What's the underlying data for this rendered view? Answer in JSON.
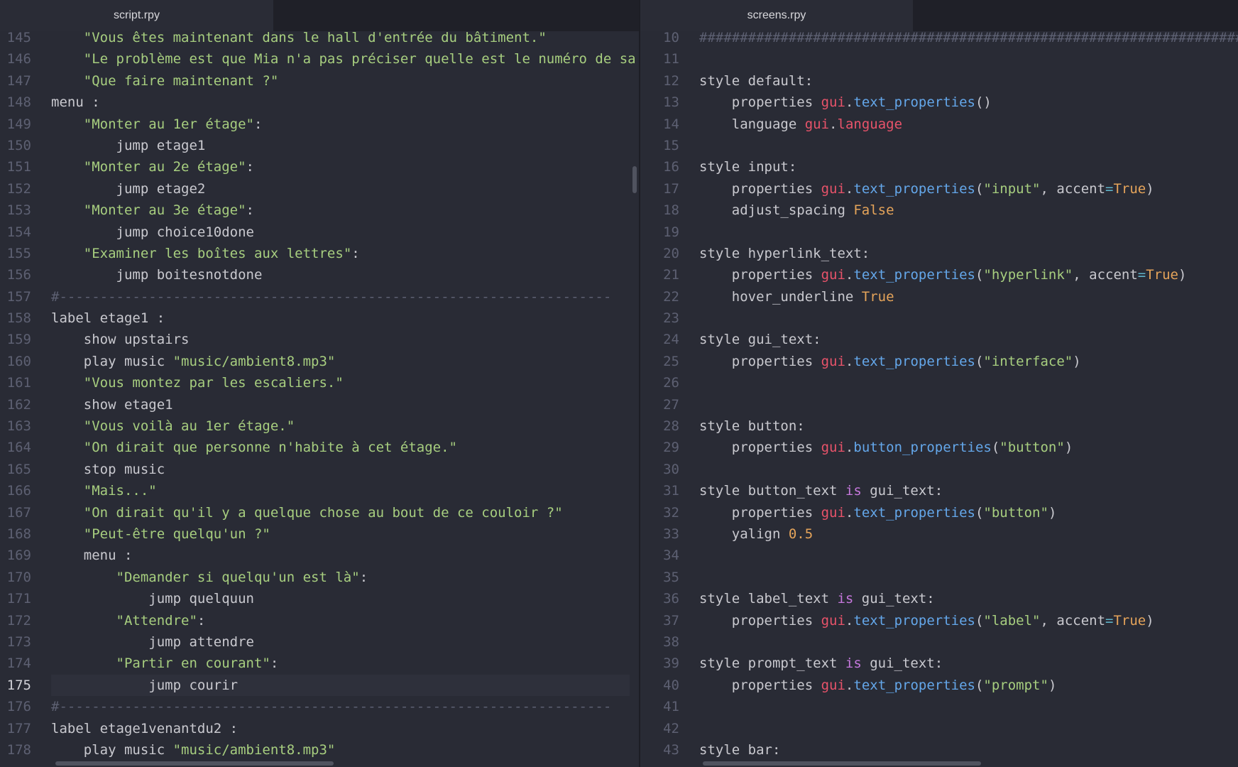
{
  "left": {
    "tab_title": "script.rpy",
    "active_line": "175",
    "lines": [
      {
        "n": "145",
        "tokens": [
          {
            "t": "    ",
            "c": "plain"
          },
          {
            "t": "\"Vous êtes maintenant dans le hall d'entrée du bâtiment.\"",
            "c": "str"
          }
        ]
      },
      {
        "n": "146",
        "tokens": [
          {
            "t": "    ",
            "c": "plain"
          },
          {
            "t": "\"Le problème est que Mia n'a pas préciser quelle est le numéro de sa",
            "c": "str"
          }
        ]
      },
      {
        "n": "147",
        "tokens": [
          {
            "t": "    ",
            "c": "plain"
          },
          {
            "t": "\"Que faire maintenant ?\"",
            "c": "str"
          }
        ]
      },
      {
        "n": "148",
        "tokens": [
          {
            "t": "menu :",
            "c": "plain"
          }
        ]
      },
      {
        "n": "149",
        "tokens": [
          {
            "t": "    ",
            "c": "plain"
          },
          {
            "t": "\"Monter au 1er étage\"",
            "c": "str"
          },
          {
            "t": ":",
            "c": "plain"
          }
        ]
      },
      {
        "n": "150",
        "tokens": [
          {
            "t": "        jump etage1",
            "c": "plain"
          }
        ]
      },
      {
        "n": "151",
        "tokens": [
          {
            "t": "    ",
            "c": "plain"
          },
          {
            "t": "\"Monter au 2e étage\"",
            "c": "str"
          },
          {
            "t": ":",
            "c": "plain"
          }
        ]
      },
      {
        "n": "152",
        "tokens": [
          {
            "t": "        jump etage2",
            "c": "plain"
          }
        ]
      },
      {
        "n": "153",
        "tokens": [
          {
            "t": "    ",
            "c": "plain"
          },
          {
            "t": "\"Monter au 3e étage\"",
            "c": "str"
          },
          {
            "t": ":",
            "c": "plain"
          }
        ]
      },
      {
        "n": "154",
        "tokens": [
          {
            "t": "        jump choice10done",
            "c": "plain"
          }
        ]
      },
      {
        "n": "155",
        "tokens": [
          {
            "t": "    ",
            "c": "plain"
          },
          {
            "t": "\"Examiner les boîtes aux lettres\"",
            "c": "str"
          },
          {
            "t": ":",
            "c": "plain"
          }
        ]
      },
      {
        "n": "156",
        "tokens": [
          {
            "t": "        jump boitesnotdone",
            "c": "plain"
          }
        ]
      },
      {
        "n": "157",
        "tokens": [
          {
            "t": "#--------------------------------------------------------------------",
            "c": "com"
          }
        ]
      },
      {
        "n": "158",
        "tokens": [
          {
            "t": "label etage1 :",
            "c": "plain"
          }
        ]
      },
      {
        "n": "159",
        "tokens": [
          {
            "t": "    show upstairs",
            "c": "plain"
          }
        ]
      },
      {
        "n": "160",
        "tokens": [
          {
            "t": "    play music ",
            "c": "plain"
          },
          {
            "t": "\"music/ambient8.mp3\"",
            "c": "str"
          }
        ]
      },
      {
        "n": "161",
        "tokens": [
          {
            "t": "    ",
            "c": "plain"
          },
          {
            "t": "\"Vous montez par les escaliers.\"",
            "c": "str"
          }
        ]
      },
      {
        "n": "162",
        "tokens": [
          {
            "t": "    show etage1",
            "c": "plain"
          }
        ]
      },
      {
        "n": "163",
        "tokens": [
          {
            "t": "    ",
            "c": "plain"
          },
          {
            "t": "\"Vous voilà au 1er étage.\"",
            "c": "str"
          }
        ]
      },
      {
        "n": "164",
        "tokens": [
          {
            "t": "    ",
            "c": "plain"
          },
          {
            "t": "\"On dirait que personne n'habite à cet étage.\"",
            "c": "str"
          }
        ]
      },
      {
        "n": "165",
        "tokens": [
          {
            "t": "    stop music",
            "c": "plain"
          }
        ]
      },
      {
        "n": "166",
        "tokens": [
          {
            "t": "    ",
            "c": "plain"
          },
          {
            "t": "\"Mais...\"",
            "c": "str"
          }
        ]
      },
      {
        "n": "167",
        "tokens": [
          {
            "t": "    ",
            "c": "plain"
          },
          {
            "t": "\"On dirait qu'il y a quelque chose au bout de ce couloir ?\"",
            "c": "str"
          }
        ]
      },
      {
        "n": "168",
        "tokens": [
          {
            "t": "    ",
            "c": "plain"
          },
          {
            "t": "\"Peut-être quelqu'un ?\"",
            "c": "str"
          }
        ]
      },
      {
        "n": "169",
        "tokens": [
          {
            "t": "    menu :",
            "c": "plain"
          }
        ]
      },
      {
        "n": "170",
        "tokens": [
          {
            "t": "        ",
            "c": "plain"
          },
          {
            "t": "\"Demander si quelqu'un est là\"",
            "c": "str"
          },
          {
            "t": ":",
            "c": "plain"
          }
        ]
      },
      {
        "n": "171",
        "tokens": [
          {
            "t": "            jump quelquun",
            "c": "plain"
          }
        ]
      },
      {
        "n": "172",
        "tokens": [
          {
            "t": "        ",
            "c": "plain"
          },
          {
            "t": "\"Attendre\"",
            "c": "str"
          },
          {
            "t": ":",
            "c": "plain"
          }
        ]
      },
      {
        "n": "173",
        "tokens": [
          {
            "t": "            jump attendre",
            "c": "plain"
          }
        ]
      },
      {
        "n": "174",
        "tokens": [
          {
            "t": "        ",
            "c": "plain"
          },
          {
            "t": "\"Partir en courant\"",
            "c": "str"
          },
          {
            "t": ":",
            "c": "plain"
          }
        ]
      },
      {
        "n": "175",
        "tokens": [
          {
            "t": "            jump courir",
            "c": "plain"
          }
        ]
      },
      {
        "n": "176",
        "tokens": [
          {
            "t": "#--------------------------------------------------------------------",
            "c": "com"
          }
        ]
      },
      {
        "n": "177",
        "tokens": [
          {
            "t": "label etage1venantdu2 :",
            "c": "plain"
          }
        ]
      },
      {
        "n": "178",
        "tokens": [
          {
            "t": "    play music ",
            "c": "plain"
          },
          {
            "t": "\"music/ambient8.mp3\"",
            "c": "str"
          }
        ]
      }
    ]
  },
  "right": {
    "tab_title": "screens.rpy",
    "lines": [
      {
        "n": "10",
        "tokens": [
          {
            "t": "########################################################################",
            "c": "com"
          }
        ]
      },
      {
        "n": "11",
        "tokens": []
      },
      {
        "n": "12",
        "tokens": [
          {
            "t": "style default:",
            "c": "plain"
          }
        ]
      },
      {
        "n": "13",
        "tokens": [
          {
            "t": "    properties ",
            "c": "plain"
          },
          {
            "t": "gui",
            "c": "red"
          },
          {
            "t": ".",
            "c": "plain"
          },
          {
            "t": "text_properties",
            "c": "blue"
          },
          {
            "t": "()",
            "c": "plain"
          }
        ]
      },
      {
        "n": "14",
        "tokens": [
          {
            "t": "    language ",
            "c": "plain"
          },
          {
            "t": "gui",
            "c": "red"
          },
          {
            "t": ".",
            "c": "plain"
          },
          {
            "t": "language",
            "c": "red"
          }
        ]
      },
      {
        "n": "15",
        "tokens": []
      },
      {
        "n": "16",
        "tokens": [
          {
            "t": "style input:",
            "c": "plain"
          }
        ]
      },
      {
        "n": "17",
        "tokens": [
          {
            "t": "    properties ",
            "c": "plain"
          },
          {
            "t": "gui",
            "c": "red"
          },
          {
            "t": ".",
            "c": "plain"
          },
          {
            "t": "text_properties",
            "c": "blue"
          },
          {
            "t": "(",
            "c": "plain"
          },
          {
            "t": "\"input\"",
            "c": "str"
          },
          {
            "t": ", accent",
            "c": "plain"
          },
          {
            "t": "=",
            "c": "op"
          },
          {
            "t": "True",
            "c": "orange"
          },
          {
            "t": ")",
            "c": "plain"
          }
        ]
      },
      {
        "n": "18",
        "tokens": [
          {
            "t": "    adjust_spacing ",
            "c": "plain"
          },
          {
            "t": "False",
            "c": "orange"
          }
        ]
      },
      {
        "n": "19",
        "tokens": []
      },
      {
        "n": "20",
        "tokens": [
          {
            "t": "style hyperlink_text:",
            "c": "plain"
          }
        ]
      },
      {
        "n": "21",
        "tokens": [
          {
            "t": "    properties ",
            "c": "plain"
          },
          {
            "t": "gui",
            "c": "red"
          },
          {
            "t": ".",
            "c": "plain"
          },
          {
            "t": "text_properties",
            "c": "blue"
          },
          {
            "t": "(",
            "c": "plain"
          },
          {
            "t": "\"hyperlink\"",
            "c": "str"
          },
          {
            "t": ", accent",
            "c": "plain"
          },
          {
            "t": "=",
            "c": "op"
          },
          {
            "t": "True",
            "c": "orange"
          },
          {
            "t": ")",
            "c": "plain"
          }
        ]
      },
      {
        "n": "22",
        "tokens": [
          {
            "t": "    hover_underline ",
            "c": "plain"
          },
          {
            "t": "True",
            "c": "orange"
          }
        ]
      },
      {
        "n": "23",
        "tokens": []
      },
      {
        "n": "24",
        "tokens": [
          {
            "t": "style gui_text:",
            "c": "plain"
          }
        ]
      },
      {
        "n": "25",
        "tokens": [
          {
            "t": "    properties ",
            "c": "plain"
          },
          {
            "t": "gui",
            "c": "red"
          },
          {
            "t": ".",
            "c": "plain"
          },
          {
            "t": "text_properties",
            "c": "blue"
          },
          {
            "t": "(",
            "c": "plain"
          },
          {
            "t": "\"interface\"",
            "c": "str"
          },
          {
            "t": ")",
            "c": "plain"
          }
        ]
      },
      {
        "n": "26",
        "tokens": []
      },
      {
        "n": "27",
        "tokens": []
      },
      {
        "n": "28",
        "tokens": [
          {
            "t": "style button:",
            "c": "plain"
          }
        ]
      },
      {
        "n": "29",
        "tokens": [
          {
            "t": "    properties ",
            "c": "plain"
          },
          {
            "t": "gui",
            "c": "red"
          },
          {
            "t": ".",
            "c": "plain"
          },
          {
            "t": "button_properties",
            "c": "blue"
          },
          {
            "t": "(",
            "c": "plain"
          },
          {
            "t": "\"button\"",
            "c": "str"
          },
          {
            "t": ")",
            "c": "plain"
          }
        ]
      },
      {
        "n": "30",
        "tokens": []
      },
      {
        "n": "31",
        "tokens": [
          {
            "t": "style button_text ",
            "c": "plain"
          },
          {
            "t": "is",
            "c": "purple"
          },
          {
            "t": " gui_text:",
            "c": "plain"
          }
        ]
      },
      {
        "n": "32",
        "tokens": [
          {
            "t": "    properties ",
            "c": "plain"
          },
          {
            "t": "gui",
            "c": "red"
          },
          {
            "t": ".",
            "c": "plain"
          },
          {
            "t": "text_properties",
            "c": "blue"
          },
          {
            "t": "(",
            "c": "plain"
          },
          {
            "t": "\"button\"",
            "c": "str"
          },
          {
            "t": ")",
            "c": "plain"
          }
        ]
      },
      {
        "n": "33",
        "tokens": [
          {
            "t": "    yalign ",
            "c": "plain"
          },
          {
            "t": "0.5",
            "c": "orange"
          }
        ]
      },
      {
        "n": "34",
        "tokens": []
      },
      {
        "n": "35",
        "tokens": []
      },
      {
        "n": "36",
        "tokens": [
          {
            "t": "style label_text ",
            "c": "plain"
          },
          {
            "t": "is",
            "c": "purple"
          },
          {
            "t": " gui_text:",
            "c": "plain"
          }
        ]
      },
      {
        "n": "37",
        "tokens": [
          {
            "t": "    properties ",
            "c": "plain"
          },
          {
            "t": "gui",
            "c": "red"
          },
          {
            "t": ".",
            "c": "plain"
          },
          {
            "t": "text_properties",
            "c": "blue"
          },
          {
            "t": "(",
            "c": "plain"
          },
          {
            "t": "\"label\"",
            "c": "str"
          },
          {
            "t": ", accent",
            "c": "plain"
          },
          {
            "t": "=",
            "c": "op"
          },
          {
            "t": "True",
            "c": "orange"
          },
          {
            "t": ")",
            "c": "plain"
          }
        ]
      },
      {
        "n": "38",
        "tokens": []
      },
      {
        "n": "39",
        "tokens": [
          {
            "t": "style prompt_text ",
            "c": "plain"
          },
          {
            "t": "is",
            "c": "purple"
          },
          {
            "t": " gui_text:",
            "c": "plain"
          }
        ]
      },
      {
        "n": "40",
        "tokens": [
          {
            "t": "    properties ",
            "c": "plain"
          },
          {
            "t": "gui",
            "c": "red"
          },
          {
            "t": ".",
            "c": "plain"
          },
          {
            "t": "text_properties",
            "c": "blue"
          },
          {
            "t": "(",
            "c": "plain"
          },
          {
            "t": "\"prompt\"",
            "c": "str"
          },
          {
            "t": ")",
            "c": "plain"
          }
        ]
      },
      {
        "n": "41",
        "tokens": []
      },
      {
        "n": "42",
        "tokens": []
      },
      {
        "n": "43",
        "tokens": [
          {
            "t": "style bar:",
            "c": "plain"
          }
        ]
      }
    ]
  }
}
